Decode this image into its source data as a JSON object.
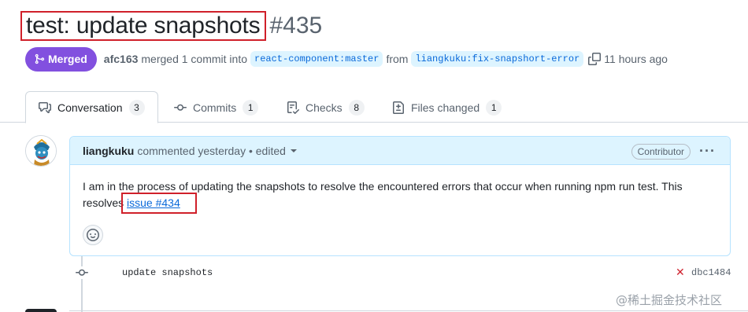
{
  "pr": {
    "title": "test: update snapshots",
    "number": "#435",
    "status": "Merged",
    "author": "afc163",
    "action": "merged 1 commit into",
    "base_branch": "react-component:master",
    "from_word": "from",
    "head_branch": "liangkuku:fix-snapshort-error",
    "time": "11 hours ago"
  },
  "tabs": [
    {
      "label": "Conversation",
      "count": "3",
      "icon": "comment-discussion-icon"
    },
    {
      "label": "Commits",
      "count": "1",
      "icon": "git-commit-icon"
    },
    {
      "label": "Checks",
      "count": "8",
      "icon": "checklist-icon"
    },
    {
      "label": "Files changed",
      "count": "1",
      "icon": "file-diff-icon"
    }
  ],
  "comment": {
    "author": "liangkuku",
    "meta": "commented yesterday • edited",
    "badge": "Contributor",
    "body_text": "I am in the process of updating the snapshots to resolve the encountered errors that occur when running npm run test. This resolves",
    "link_text": "issue #434"
  },
  "commit": {
    "message": "update snapshots",
    "status": "✕",
    "sha": "dbc1484"
  },
  "watermark": "@稀土掘金技术社区",
  "colors": {
    "merged": "#8250df",
    "link": "#0969da",
    "highlight": "#d0202a",
    "header_bg": "#ddf4ff"
  }
}
